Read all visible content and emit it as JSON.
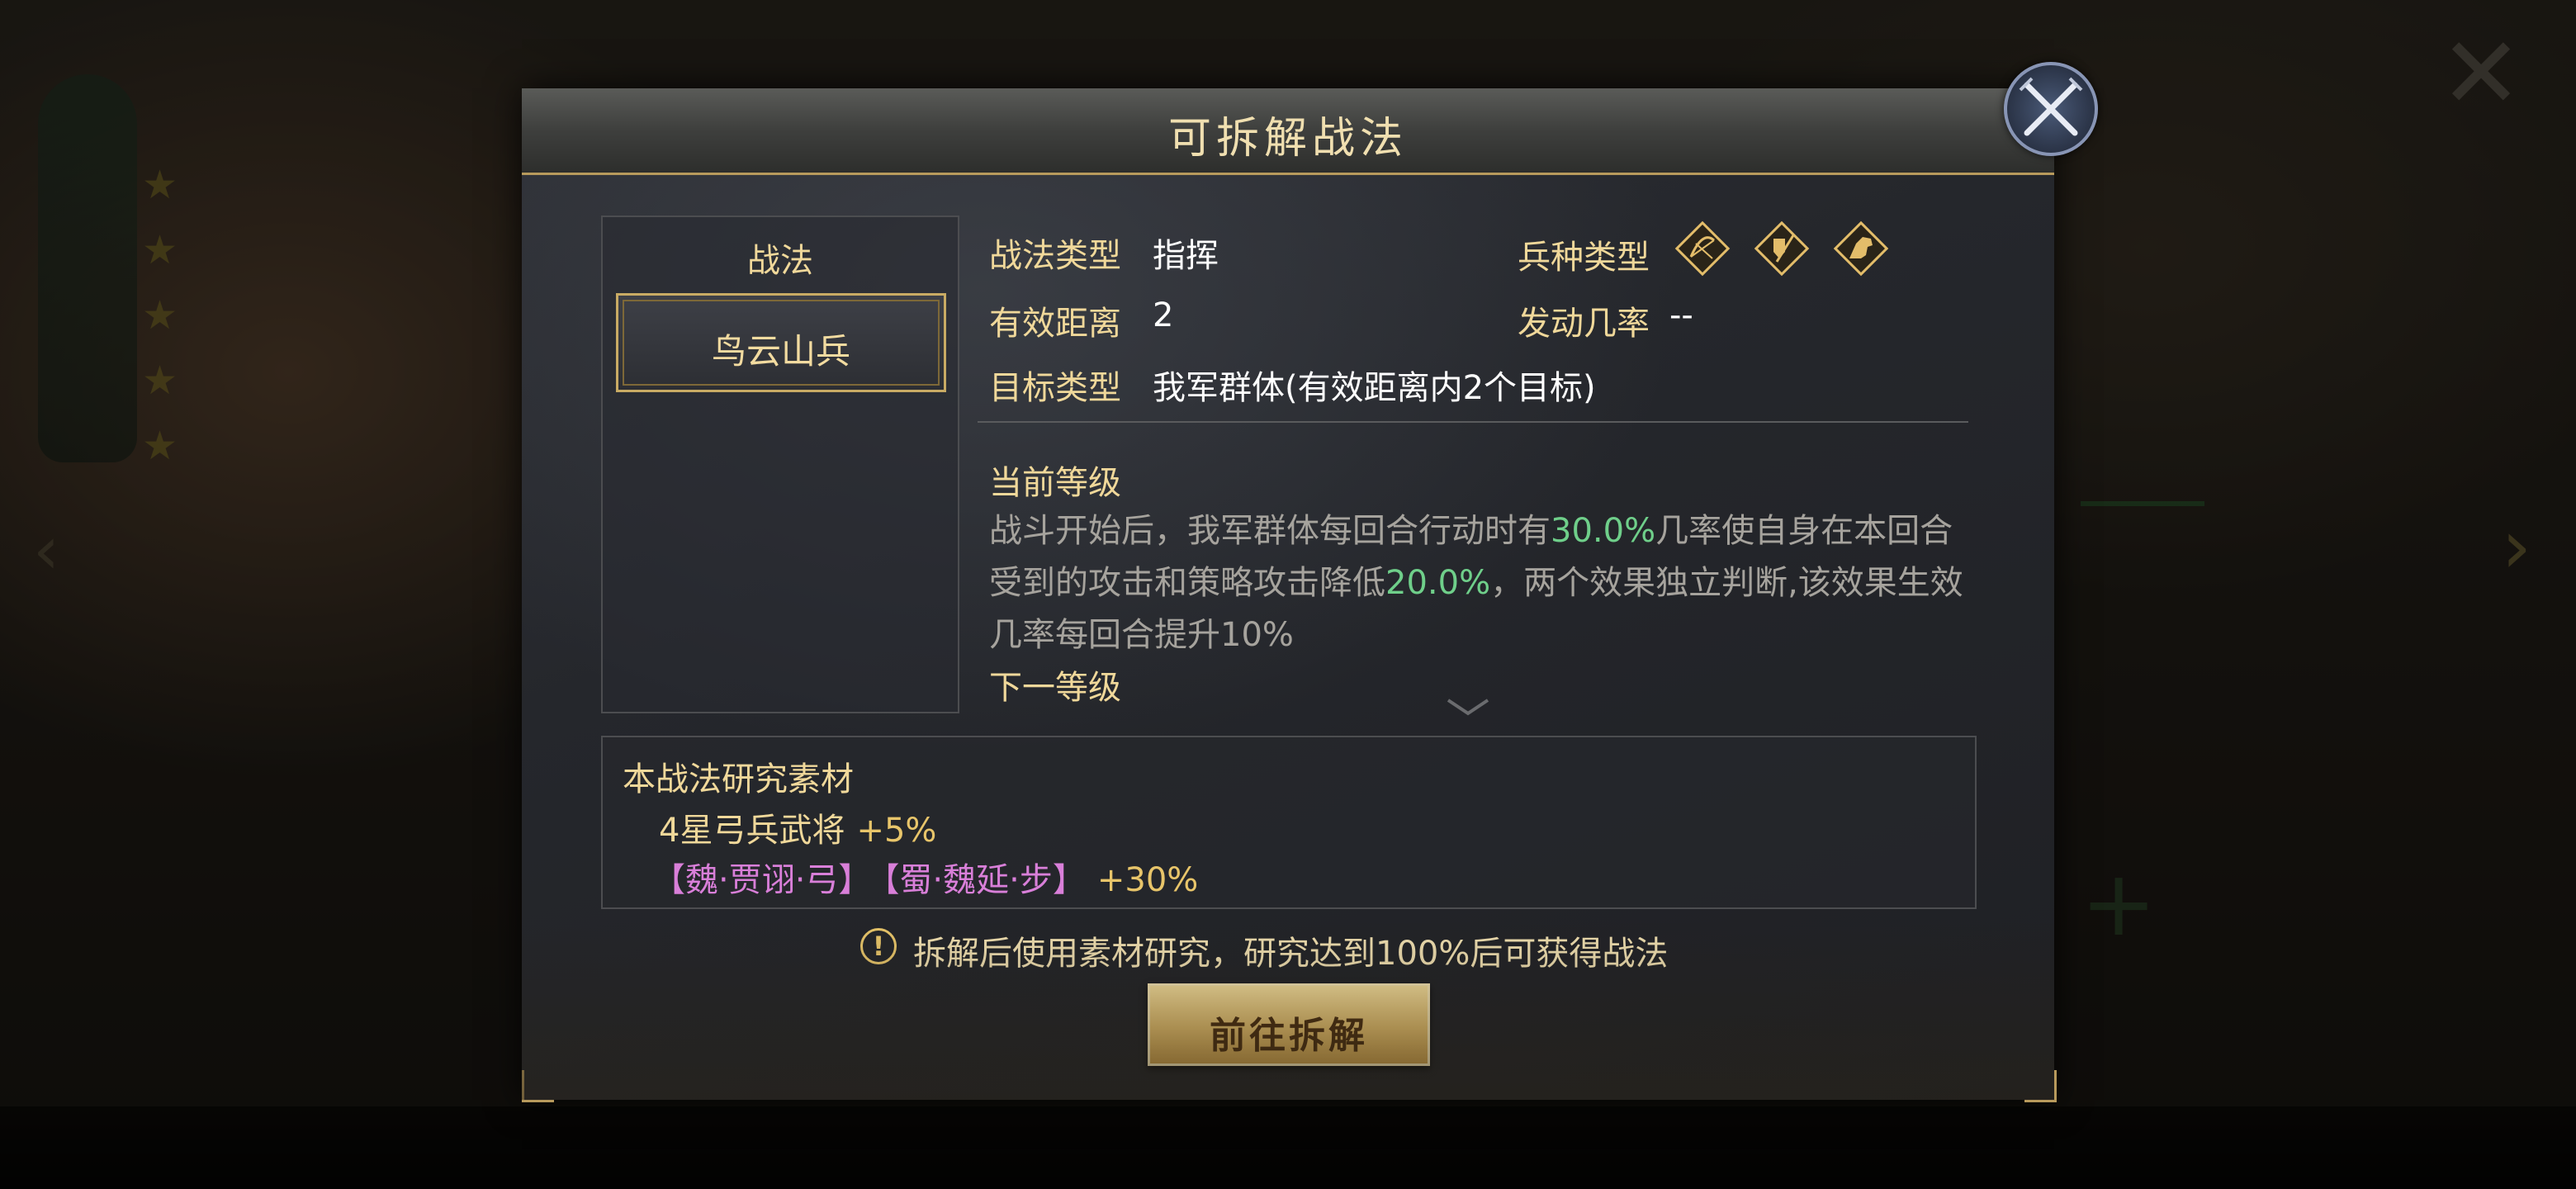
{
  "dialog": {
    "title": "可拆解战法",
    "close_icon": "crossed-swords-close-icon"
  },
  "skill_panel": {
    "header": "战法",
    "selected_skill": "鸟云山兵"
  },
  "info": {
    "skill_type_label": "战法类型",
    "skill_type_value": "指挥",
    "range_label": "有效距离",
    "range_value": "2",
    "target_label": "目标类型",
    "target_value": "我军群体(有效距离内2个目标)",
    "troop_type_label": "兵种类型",
    "troop_icons": [
      "bow-icon",
      "shield-spear-icon",
      "horse-icon"
    ],
    "trigger_rate_label": "发动几率",
    "trigger_rate_value": "--"
  },
  "level": {
    "current_label": "当前等级",
    "desc_part1": "战斗开始后，我军群体每回合行动时有",
    "desc_pct1": "30.0%",
    "desc_part2": "几率使自身在本回合受到的攻击和策略攻击降低",
    "desc_pct2": "20.0%",
    "desc_part3": "，两个效果独立判断,该效果生效几率每回合提升10%",
    "next_label": "下一等级"
  },
  "materials": {
    "title": "本战法研究素材",
    "row1_text": "4星弓兵武将",
    "row1_bonus": "+5%",
    "general1": "【魏·贾诩·弓】",
    "general2": "【蜀·魏延·步】",
    "row2_bonus": "+30%"
  },
  "hint": {
    "icon": "exclamation-circle-icon",
    "text": "拆解后使用素材研究，研究达到100%后可获得战法"
  },
  "action_button": {
    "label": "前往拆解"
  },
  "colors": {
    "gold_text": "#f0d89a",
    "highlight_green": "#6fcf8a",
    "general_purple": "#d97fd9",
    "button_gold": "#e3bd6a"
  }
}
